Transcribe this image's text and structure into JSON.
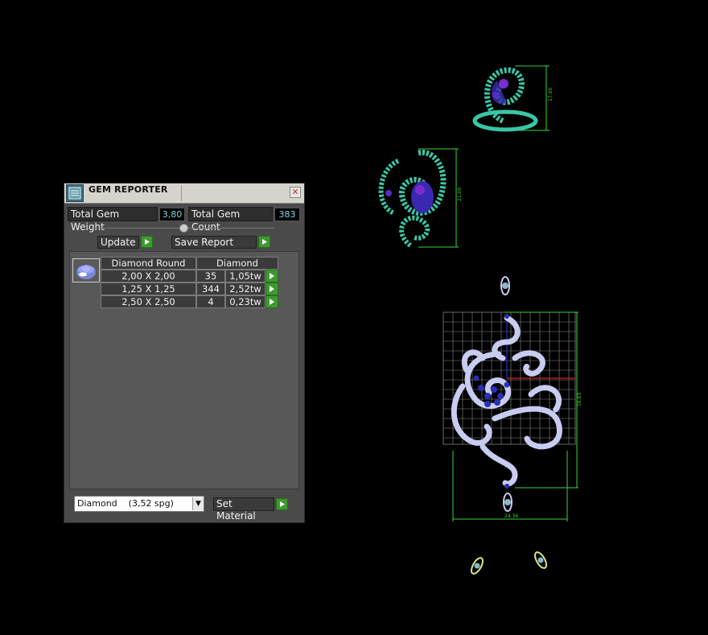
{
  "panel": {
    "title": "GEM REPORTER",
    "close": "✕",
    "total_weight_label": "Total Gem Weight",
    "total_weight_value": "3,80",
    "total_count_label": "Total Gem Count",
    "total_count_value": "383",
    "update_label": "Update",
    "save_report_label": "Save Report",
    "table": {
      "headers": [
        "Diamond Round",
        "Diamond"
      ],
      "rows": [
        {
          "size": "2,00 X 2,00",
          "count": "35",
          "weight": "1,05tw"
        },
        {
          "size": "1,25 X 1,25",
          "count": "344",
          "weight": "2,52tw"
        },
        {
          "size": "2,50 X 2,50",
          "count": "4",
          "weight": "0,23tw"
        }
      ]
    },
    "material_selected": "Diamond    (3,52 spg)",
    "set_material_label": "Set Material"
  },
  "viewport": {
    "accent_green": "#3cd23c",
    "gem_teal": "#39c6a6",
    "gem_blue": "#3a28b0",
    "gem_white": "#c8ccf0",
    "dim_labels": [
      "17.00",
      "21.00",
      "16.63",
      "24.36"
    ]
  }
}
